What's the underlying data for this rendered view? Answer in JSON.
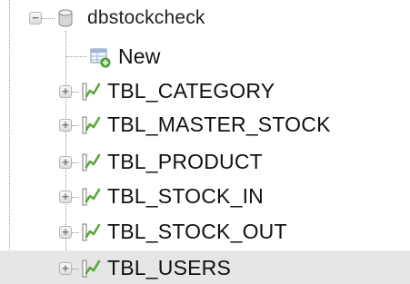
{
  "tree": {
    "database": {
      "label": "dbstockcheck",
      "icon": "database-icon",
      "expanded": true
    },
    "new_item": {
      "label": "New",
      "icon": "new-table-icon"
    },
    "tables": [
      {
        "label": "TBL_CATEGORY",
        "icon": "table-icon",
        "selected": false
      },
      {
        "label": "TBL_MASTER_STOCK",
        "icon": "table-icon",
        "selected": false
      },
      {
        "label": "TBL_PRODUCT",
        "icon": "table-icon",
        "selected": false
      },
      {
        "label": "TBL_STOCK_IN",
        "icon": "table-icon",
        "selected": false
      },
      {
        "label": "TBL_STOCK_OUT",
        "icon": "table-icon",
        "selected": false
      },
      {
        "label": "TBL_USERS",
        "icon": "table-icon",
        "selected": true
      }
    ],
    "colors": {
      "selected_row": "#e6e6e6",
      "table_icon_green": "#5aa83a",
      "text": "#111111"
    }
  }
}
